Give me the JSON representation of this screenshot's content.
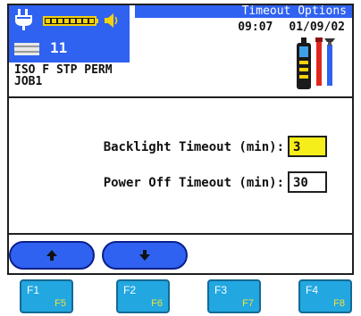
{
  "header": {
    "title": "Timeout Options",
    "time": "09:07",
    "date": "01/09/02",
    "count": "11",
    "test_standard": "ISO F STP PERM",
    "job": "JOB1"
  },
  "icons": {
    "power": "plug-icon",
    "battery": "battery-icon",
    "sound": "speaker-icon",
    "cable": "cable-icon",
    "tools": "tools-icon"
  },
  "form": {
    "backlight_label": "Backlight Timeout (min):",
    "backlight_value": "3",
    "poweroff_label": "Power Off Timeout (min):",
    "poweroff_value": "30"
  },
  "nav": {
    "up_icon": "arrow-up-icon",
    "down_icon": "arrow-down-icon"
  },
  "fkeys": [
    {
      "primary": "F1",
      "secondary": "F5"
    },
    {
      "primary": "F2",
      "secondary": "F6"
    },
    {
      "primary": "F3",
      "secondary": "F7"
    },
    {
      "primary": "F4",
      "secondary": "F8"
    }
  ],
  "colors": {
    "header_blue": "#2f62f0",
    "active_field": "#f5ee1a",
    "fkey_blue": "#22a7e0",
    "fkey_secondary": "#f3e23a"
  }
}
